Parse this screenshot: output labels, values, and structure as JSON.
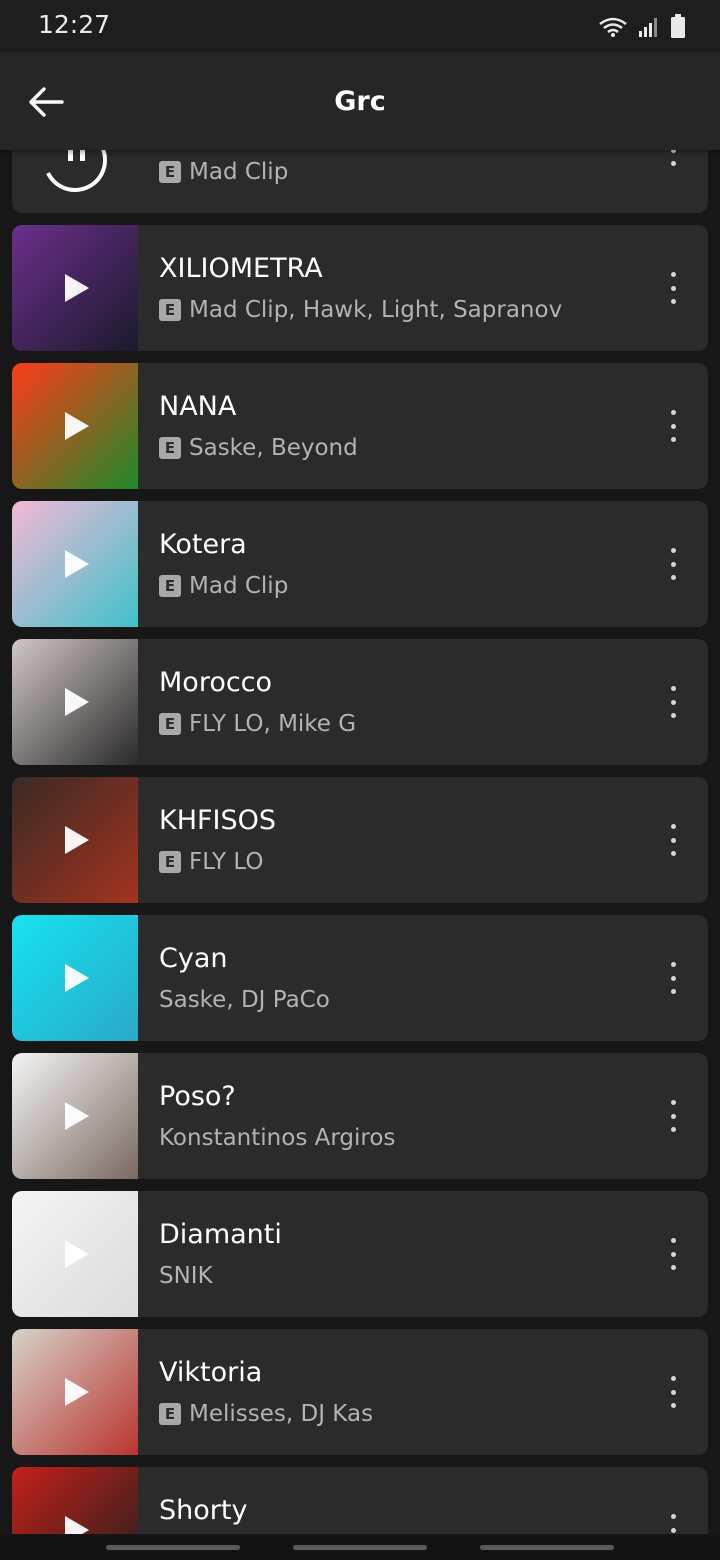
{
  "status": {
    "time": "12:27"
  },
  "header": {
    "title": "Grc",
    "back_icon": "arrow-left-icon"
  },
  "explicit_label": "E",
  "tracks": [
    {
      "title": "",
      "artists": "Mad Clip",
      "explicit": true,
      "cover_colors": [
        "#2b2b2b",
        "#2b2b2b"
      ]
    },
    {
      "title": "XILIOMETRA",
      "artists": "Mad Clip, Hawk, Light, Sapranov",
      "explicit": true,
      "cover_colors": [
        "#6b2f8c",
        "#1a1a2a"
      ]
    },
    {
      "title": "NANA",
      "artists": "Saske, Beyond",
      "explicit": true,
      "cover_colors": [
        "#ff3a1a",
        "#1d8a2a"
      ]
    },
    {
      "title": "Kotera",
      "artists": "Mad Clip",
      "explicit": true,
      "cover_colors": [
        "#f4b8d6",
        "#3fc1c9"
      ]
    },
    {
      "title": "Morocco",
      "artists": "FLY LO, Mike G",
      "explicit": true,
      "cover_colors": [
        "#cfc7c4",
        "#2a2a2a"
      ]
    },
    {
      "title": "KHFISOS",
      "artists": "FLY LO",
      "explicit": true,
      "cover_colors": [
        "#3a2a24",
        "#a4331f"
      ]
    },
    {
      "title": "Cyan",
      "artists": "Saske, DJ PaCo",
      "explicit": false,
      "cover_colors": [
        "#16e3f0",
        "#2aa9c7"
      ]
    },
    {
      "title": "Poso?",
      "artists": "Konstantinos Argiros",
      "explicit": false,
      "cover_colors": [
        "#f4f4f4",
        "#7a6a60"
      ]
    },
    {
      "title": "Diamanti",
      "artists": "SNIK",
      "explicit": false,
      "cover_colors": [
        "#f4f4f4",
        "#dcdcdc"
      ]
    },
    {
      "title": "Viktoria",
      "artists": "Melisses, DJ Kas",
      "explicit": true,
      "cover_colors": [
        "#d6d3c9",
        "#b8352e"
      ]
    },
    {
      "title": "Shorty",
      "artists": "",
      "explicit": false,
      "cover_colors": [
        "#c42018",
        "#1f1f1f"
      ]
    }
  ]
}
